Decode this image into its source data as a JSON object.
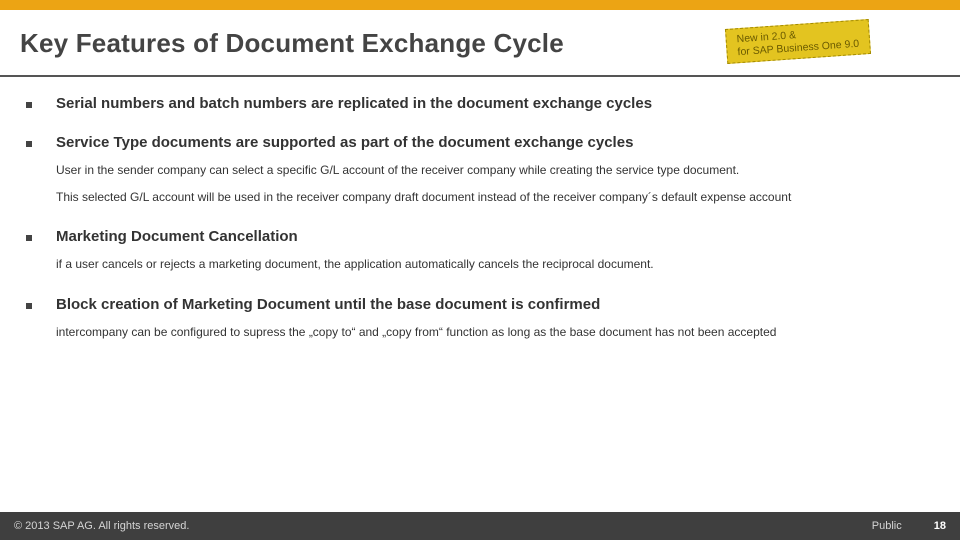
{
  "header": {
    "title": "Key Features of Document Exchange Cycle",
    "stamp_line1": "New in 2.0 &",
    "stamp_line2": "for SAP Business One 9.0"
  },
  "features": [
    {
      "heading": "Serial numbers and batch numbers are replicated in the document exchange cycles",
      "subs": []
    },
    {
      "heading": "Service Type documents are supported as part of the document exchange cycles",
      "subs": [
        "User in the sender company can select a specific G/L account of the receiver company while creating the service type document.",
        "This selected G/L account will be used in the receiver company draft document instead of the receiver company´s default expense account"
      ]
    },
    {
      "heading": "Marketing Document Cancellation",
      "subs": [
        "if a user cancels or rejects a marketing document, the application automatically cancels the reciprocal document."
      ]
    },
    {
      "heading": "Block creation of Marketing Document until the base document is confirmed",
      "subs": [
        "intercompany can be configured to supress the „copy to“ and „copy from“ function as long as the base document has not been accepted"
      ]
    }
  ],
  "footer": {
    "copyright": "© 2013 SAP AG. All rights reserved.",
    "classification": "Public",
    "page": "18"
  }
}
